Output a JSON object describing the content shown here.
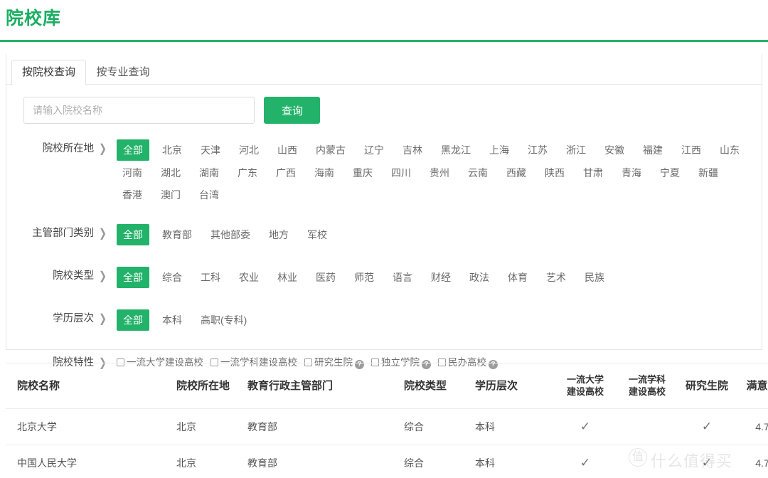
{
  "header": {
    "title": "院校库",
    "accent_color": "#22b269"
  },
  "tabs": [
    {
      "label": "按院校查询",
      "active": true
    },
    {
      "label": "按专业查询",
      "active": false
    }
  ],
  "search": {
    "placeholder": "请输入院校名称",
    "value": "",
    "button_label": "查询"
  },
  "filters": [
    {
      "label": "院校所在地",
      "selected": "全部",
      "options": [
        "全部",
        "北京",
        "天津",
        "河北",
        "山西",
        "内蒙古",
        "辽宁",
        "吉林",
        "黑龙江",
        "上海",
        "江苏",
        "浙江",
        "安徽",
        "福建",
        "江西",
        "山东",
        "河南",
        "湖北",
        "湖南",
        "广东",
        "广西",
        "海南",
        "重庆",
        "四川",
        "贵州",
        "云南",
        "西藏",
        "陕西",
        "甘肃",
        "青海",
        "宁夏",
        "新疆",
        "香港",
        "澳门",
        "台湾"
      ]
    },
    {
      "label": "主管部门类别",
      "selected": "全部",
      "options": [
        "全部",
        "教育部",
        "其他部委",
        "地方",
        "军校"
      ]
    },
    {
      "label": "院校类型",
      "selected": "全部",
      "options": [
        "全部",
        "综合",
        "工科",
        "农业",
        "林业",
        "医药",
        "师范",
        "语言",
        "财经",
        "政法",
        "体育",
        "艺术",
        "民族"
      ]
    },
    {
      "label": "学历层次",
      "selected": "全部",
      "options": [
        "全部",
        "本科",
        "高职(专科)"
      ]
    }
  ],
  "characteristics": {
    "label": "院校特性",
    "checkboxes": [
      {
        "label": "一流大学建设高校",
        "checked": false,
        "help": false
      },
      {
        "label": "一流学科建设高校",
        "checked": false,
        "help": false
      },
      {
        "label": "研究生院",
        "checked": false,
        "help": true
      },
      {
        "label": "独立学院",
        "checked": false,
        "help": true
      },
      {
        "label": "民办高校",
        "checked": false,
        "help": true
      }
    ],
    "help_glyph": "?"
  },
  "table": {
    "columns": [
      {
        "key": "name",
        "label": "院校名称",
        "lines": [
          "院校名称"
        ]
      },
      {
        "key": "loc",
        "label": "院校所在地",
        "lines": [
          "院校所在地"
        ]
      },
      {
        "key": "dept",
        "label": "教育行政主管部门",
        "lines": [
          "教育行政主管部门"
        ]
      },
      {
        "key": "type",
        "label": "院校类型",
        "lines": [
          "院校类型"
        ]
      },
      {
        "key": "level",
        "label": "学历层次",
        "lines": [
          "学历层次"
        ]
      },
      {
        "key": "u1",
        "label": "一流大学建设高校",
        "lines": [
          "一流大学",
          "建设高校"
        ]
      },
      {
        "key": "u2",
        "label": "一流学科建设高校",
        "lines": [
          "一流学科",
          "建设高校"
        ]
      },
      {
        "key": "grad",
        "label": "研究生院",
        "lines": [
          "研究生院"
        ]
      },
      {
        "key": "score",
        "label": "满意度",
        "lines": [
          "满意度"
        ]
      }
    ],
    "check_glyph": "✓",
    "rows": [
      {
        "name": "北京大学",
        "loc": "北京",
        "dept": "教育部",
        "type": "综合",
        "level": "本科",
        "u1": true,
        "u2": false,
        "grad": true,
        "score": "4.7"
      },
      {
        "name": "中国人民大学",
        "loc": "北京",
        "dept": "教育部",
        "type": "综合",
        "level": "本科",
        "u1": true,
        "u2": false,
        "grad": true,
        "score": "4.7"
      }
    ]
  },
  "watermark": {
    "mark": "值",
    "text": "什么值得买"
  }
}
